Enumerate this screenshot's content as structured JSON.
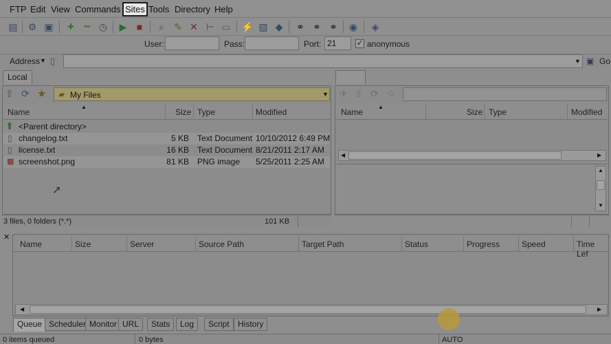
{
  "menu": {
    "items": [
      "FTP",
      "Edit",
      "View",
      "Commands",
      "Sites",
      "Tools",
      "Directory",
      "Help"
    ],
    "active": "Sites"
  },
  "login": {
    "user_label": "User:",
    "user_value": "",
    "pass_label": "Pass:",
    "pass_value": "",
    "port_label": "Port:",
    "port_value": "21",
    "anon_label": "anonymous",
    "anon_checked": true
  },
  "address": {
    "label": "Address",
    "value": "",
    "go_label": "Go"
  },
  "local": {
    "tab": "Local",
    "path": "My Files",
    "columns": [
      "Name",
      "Size",
      "Type",
      "Modified"
    ],
    "parent": "<Parent directory>",
    "files": [
      {
        "name": "changelog.txt",
        "size": "5 KB",
        "type": "Text Document",
        "modified": "10/10/2012 6:49 PM",
        "icon": "text-file-icon"
      },
      {
        "name": "license.txt",
        "size": "16 KB",
        "type": "Text Document",
        "modified": "8/21/2011 2:17 AM",
        "icon": "text-file-icon"
      },
      {
        "name": "screenshot.png",
        "size": "81 KB",
        "type": "PNG image",
        "modified": "5/25/2011 2:25 AM",
        "icon": "image-file-icon"
      }
    ],
    "status_left": "3 files, 0 folders (*.*)",
    "status_right": "101 KB"
  },
  "remote": {
    "tab": "",
    "columns": [
      "Name",
      "Size",
      "Type",
      "Modified"
    ]
  },
  "queue": {
    "columns": [
      "Name",
      "Size",
      "Server",
      "Source Path",
      "Target Path",
      "Status",
      "Progress",
      "Speed",
      "Time Lef"
    ],
    "tabs": [
      "Queue",
      "Scheduler",
      "Monitor",
      "URL",
      "Stats",
      "Log",
      "Script",
      "History"
    ],
    "selected_tab": "Queue"
  },
  "statusbar": {
    "items": "0 items queued",
    "bytes": "0 bytes",
    "mode": "AUTO"
  },
  "colors": {
    "overlay": "#8e8e8e",
    "path_bg": "#a39a6a",
    "highlight": "#1a1a1a"
  }
}
